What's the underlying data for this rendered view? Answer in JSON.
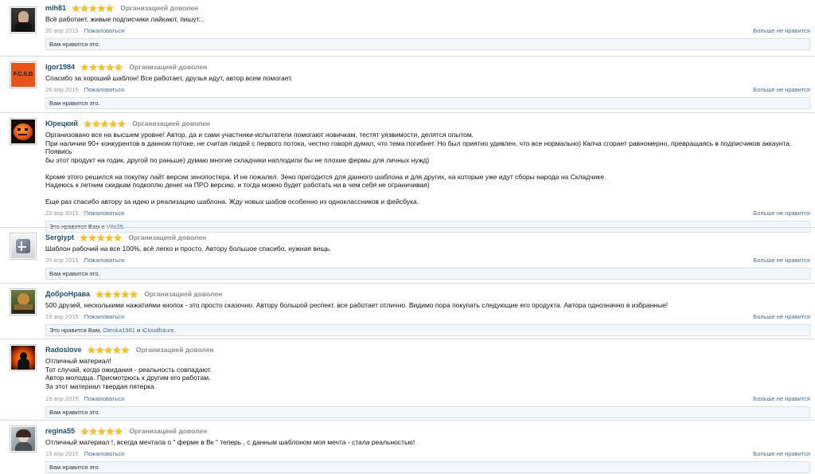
{
  "verdict_label": "Организацией доволен",
  "complain_label": "Пожаловаться",
  "dislike_label": "Больше не нравится",
  "star_color": "#f2c32b",
  "reviews": [
    {
      "username": "mih81",
      "rating": 5,
      "text": "Всё работает, живые подписчики лайкают, пишут...",
      "date": "26 апр 2015",
      "likes_text": "Вам нравится это."
    },
    {
      "username": "Igor1984",
      "avatar_text": "F.C.S.D",
      "rating": 5,
      "text": "Спасибо за хороший шаблон! Все работает, друзья идут, автор всем помогает.",
      "date": "26 апр 2015",
      "likes_text": "Вам нравится это."
    },
    {
      "username": "Юрецкий",
      "rating": 5,
      "text_lines": [
        "Организовано все на высшем уровне! Автор, да и сами участники-испытатели помогают новичкам, тестят уязвимости, делятся опытом.",
        "При наличии 90+ конкурентов в данном потоке, не считая людей с первого потока, честно говоря думал, что тема погибнет. Но был приятно удивлен, что все нормально) Капча сгорает равномерно, превращаясь в подписчиков аккаунта. Появись",
        "бы этот продукт на годик, другой по раньше) думаю многие складчики наплодили бы не плохие фермы для личных нужд)",
        "",
        "Кроме этого решился на покупку лайт версии зенопостера. И не пожалел. Зено пригодится для данного шаблона и для других, на которые уже идут сборы народа на Складчике.",
        "Надеюсь к летним скидкам подкоплю денег на ПРО версию, и тогда можно будет работать ни в чем себя не ограничивая)",
        "",
        "Еще раз спасибо автору за идею и реализацию шаблона. Жду новых шабов особенно из одноклассников и фейсбука."
      ],
      "date": "23 апр 2015",
      "likes_prefix": "Это нравится Вам и",
      "likes_users": [
        "Vito25"
      ],
      "likes_suffix": "."
    },
    {
      "username": "Sergiypt",
      "rating": 5,
      "text": "Шаблон рабочий на все 100%, всё легко и просто. Автору большое спасибо, нужная вещь.",
      "date": "20 апр 2015",
      "likes_text": "Вам нравится это."
    },
    {
      "username": "ДоброНрава",
      "rating": 5,
      "text": "500 друзей, несколькими нажатиями кнопок - это просто сказочно. Автору большой респект. все работает отлично. Видимо пора покупать следующие его продукта. Автора однозначно в избранные!",
      "date": "19 апр 2015",
      "likes_prefix": "Это нравится Вам,",
      "likes_users": [
        "Olenka1981",
        "iCloudfuture"
      ],
      "likes_joiner": " и ",
      "likes_suffix": "."
    },
    {
      "username": "Radoslove",
      "rating": 5,
      "text_lines": [
        "Отличный материал!",
        "Тот случай, когда ожидания - реальность совпадают.",
        "Автор молодца. Присмотрюсь к другим его работам.",
        "За этот материал твердая пятерка."
      ],
      "date": "19 апр 2015",
      "likes_text": "Вам нравится это."
    },
    {
      "username": "regina55",
      "rating": 5,
      "text": "Отличный материал !, всегда мечтала о \" ферме в Вк \" теперь , с данным шаблоном моя мечта - стала реальностью!",
      "date": "19 апр 2015",
      "likes_text": "Вам нравится это."
    }
  ]
}
